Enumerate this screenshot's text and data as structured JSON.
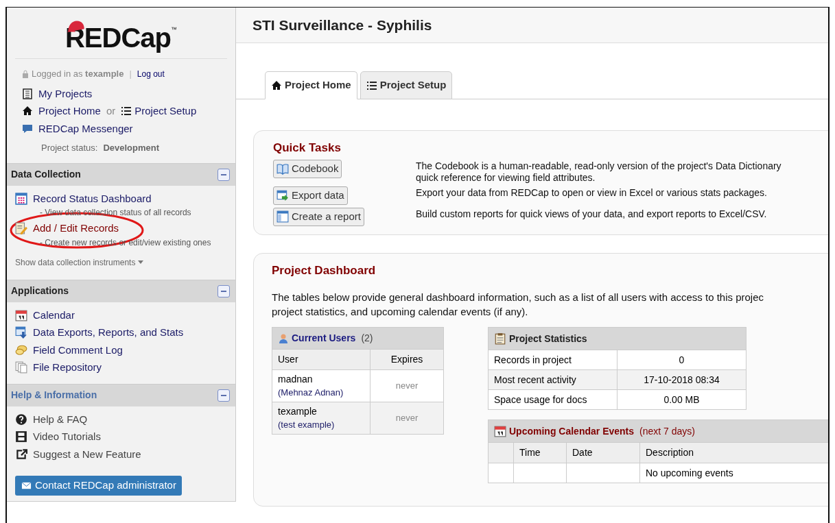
{
  "sidebar": {
    "logo": "REDCap",
    "tm": "™",
    "login": {
      "prefix": "Logged in as",
      "user": "texample",
      "separator": "|",
      "logout": "Log out"
    },
    "nav": [
      {
        "kind": "projects",
        "label": "My Projects"
      },
      {
        "kind": "home-setup",
        "label": "Project Home",
        "or": "or",
        "label2": "Project Setup"
      },
      {
        "kind": "messenger",
        "label": "REDCap Messenger"
      }
    ],
    "status": {
      "label": "Project status:",
      "value": "Development"
    },
    "sections": [
      {
        "title": "Data Collection",
        "expanded": true,
        "items": [
          {
            "kind": "grid",
            "label": "Record Status Dashboard",
            "note": "- View data collection status of all records"
          },
          {
            "kind": "edit",
            "label": "Add / Edit Records",
            "note": "- Create new records or edit/view existing ones",
            "circled": true
          }
        ],
        "toggle": "Show data collection instruments"
      },
      {
        "title": "Applications",
        "expanded": true,
        "items": [
          {
            "kind": "calendar",
            "label": "Calendar"
          },
          {
            "kind": "export",
            "label": "Data Exports, Reports, and Stats"
          },
          {
            "kind": "comment",
            "label": "Field Comment Log"
          },
          {
            "kind": "files",
            "label": "File Repository"
          }
        ]
      },
      {
        "title": "Help & Information",
        "expanded": true,
        "items": [
          {
            "kind": "help",
            "label": "Help & FAQ"
          },
          {
            "kind": "film",
            "label": "Video Tutorials"
          },
          {
            "kind": "share",
            "label": "Suggest a New Feature"
          }
        ]
      }
    ],
    "contact_button": "Contact REDCap administrator"
  },
  "header": {
    "title": "STI Surveillance - Syphilis"
  },
  "tabs": [
    {
      "kind": "home",
      "label": "Project Home",
      "selected": true
    },
    {
      "kind": "setup",
      "label": "Project Setup",
      "selected": false
    }
  ],
  "quick_tasks": {
    "title": "Quick Tasks",
    "tasks": [
      {
        "kind": "book",
        "button": "Codebook",
        "lines": [
          "The Codebook is a human-readable, read-only version of the project's Data Dictionary",
          "quick reference for viewing field attributes."
        ]
      },
      {
        "kind": "export",
        "button": "Export data",
        "lines": [
          "Export your data from REDCap to open or view in Excel or various stats packages."
        ]
      },
      {
        "kind": "report",
        "button": "Create a report",
        "lines": [
          "Build custom reports for quick views of your data, and export reports to Excel/CSV."
        ]
      }
    ]
  },
  "dashboard": {
    "title": "Project Dashboard",
    "intro": [
      "The tables below provide general dashboard information, such as a list of all users with access to this projec",
      "project statistics, and upcoming calendar events (if any)."
    ],
    "users": {
      "title": "Current Users",
      "count": "(2)",
      "columns": [
        "User",
        "Expires"
      ],
      "rows": [
        {
          "user": "madnan",
          "name": "(Mehnaz Adnan)",
          "expires": "never"
        },
        {
          "user": "texample",
          "name": "(test example)",
          "expires": "never"
        }
      ]
    },
    "stats": {
      "title": "Project Statistics",
      "rows": [
        [
          "Records in project",
          "0"
        ],
        [
          "Most recent activity",
          "17-10-2018 08:34"
        ],
        [
          "Space usage for docs",
          "0.00 MB"
        ]
      ]
    },
    "calendar": {
      "title": "Upcoming Calendar Events",
      "subtitle": "(next 7 days)",
      "columns": [
        "Time",
        "Date",
        "Description"
      ],
      "empty": "No upcoming events"
    }
  }
}
